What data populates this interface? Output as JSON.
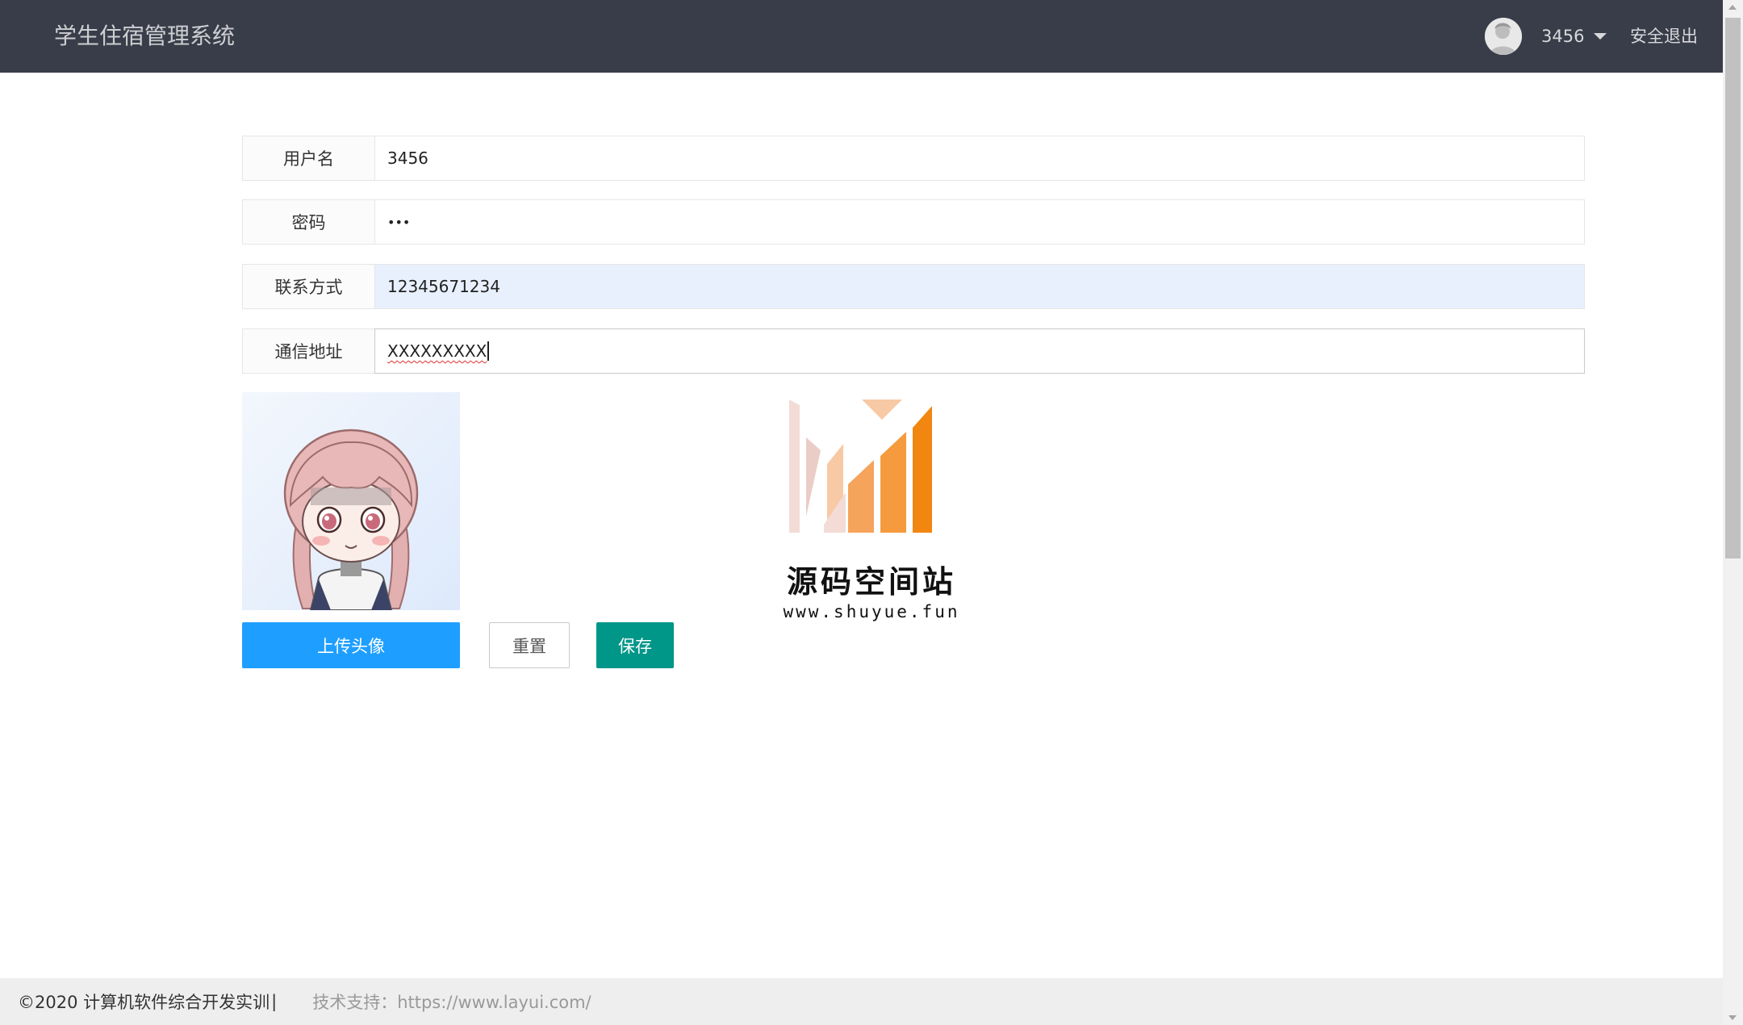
{
  "header": {
    "title": "学生住宿管理系统",
    "username": "3456",
    "logout_label": "安全退出"
  },
  "form": {
    "username_label": "用户名",
    "username_value": "3456",
    "password_label": "密码",
    "password_value": "•••",
    "contact_label": "联系方式",
    "contact_value": "12345671234",
    "address_label": "通信地址",
    "address_value": "XXXXXXXXX"
  },
  "buttons": {
    "upload_label": "上传头像",
    "reset_label": "重置",
    "save_label": "保存"
  },
  "watermark": {
    "title": "源码空间站",
    "url": "www.shuyue.fun"
  },
  "footer": {
    "copyright": "©2020 计算机软件综合开发实训",
    "separator": "|",
    "support": "技术支持：https://www.layui.com/"
  },
  "colors": {
    "header_bg": "#393d49",
    "upload_button": "#1e9fff",
    "save_button": "#009688",
    "autofill_bg": "#e8f0fe"
  },
  "icons": [
    "user-avatar-icon",
    "caret-down-icon",
    "scroll-up-icon",
    "scroll-down-icon"
  ]
}
